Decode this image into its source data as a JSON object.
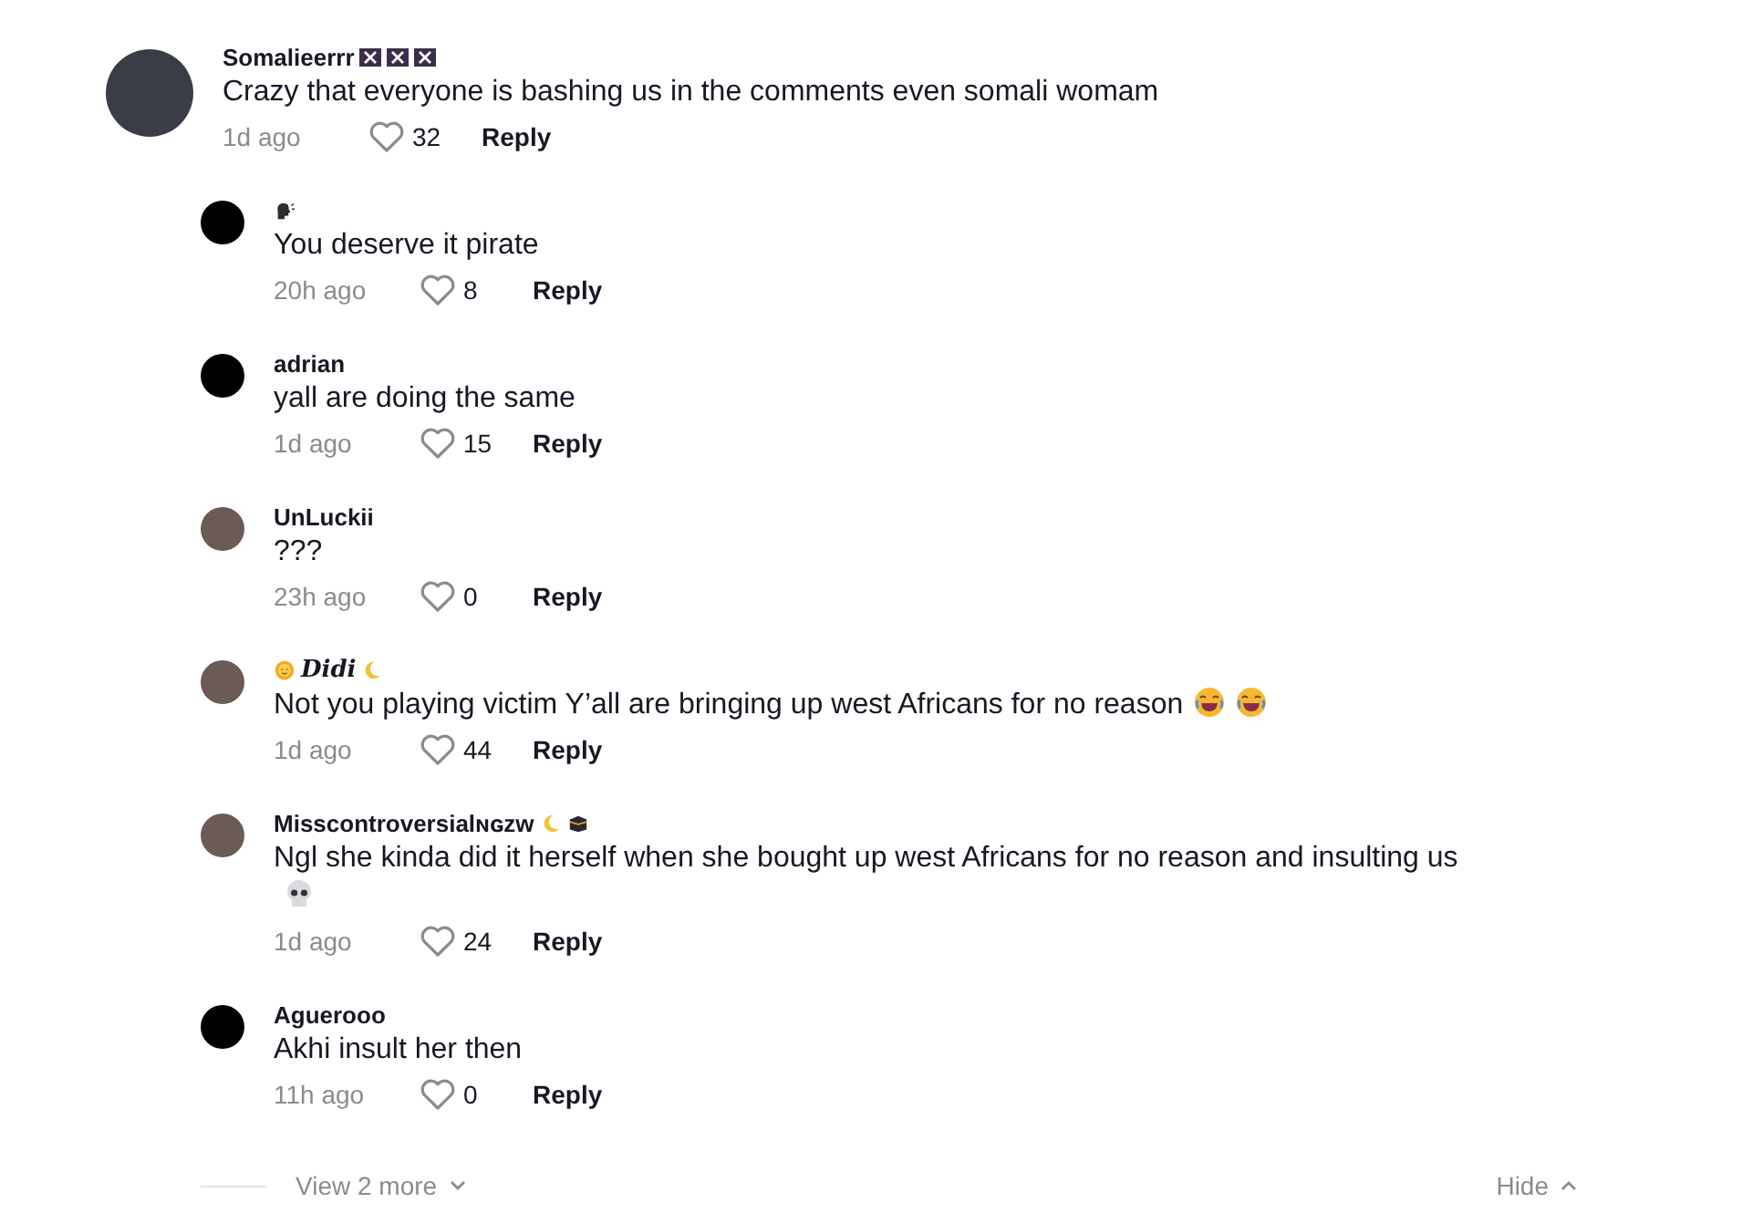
{
  "comment": {
    "author": {
      "text": "Somalieerrr",
      "kind": "plain"
    },
    "author_badges": [
      {
        "kind": "flag"
      },
      {
        "kind": "flag"
      },
      {
        "kind": "flag"
      }
    ],
    "avatar": {
      "kind": "photo"
    },
    "text": "Crazy that everyone is bashing us in the comments even somali womam",
    "time": "1d ago",
    "likes": "32",
    "reply": "Reply"
  },
  "replies": [
    {
      "author_badges_before": [
        {
          "kind": "speaking-head"
        }
      ],
      "avatar": {
        "kind": "blank"
      },
      "text": "You deserve it pirate",
      "time": "20h ago",
      "likes": "8",
      "reply": "Reply"
    },
    {
      "author": {
        "text": "adrian",
        "kind": "plain"
      },
      "avatar": {
        "kind": "blank"
      },
      "text": "yall are doing the same",
      "time": "1d ago",
      "likes": "15",
      "reply": "Reply"
    },
    {
      "author": {
        "text": "UnLuckii",
        "kind": "plain"
      },
      "avatar": {
        "kind": "photo"
      },
      "text": "???",
      "time": "23h ago",
      "likes": "0",
      "reply": "Reply"
    },
    {
      "author": {
        "text": "Didi",
        "kind": "script"
      },
      "author_badges_before": [
        {
          "kind": "sun"
        }
      ],
      "author_badges": [
        {
          "kind": "moon"
        }
      ],
      "avatar": {
        "kind": "photo"
      },
      "text": "Not you playing victim Y’all are bringing up west Africans for no reason",
      "emojis": [
        {
          "kind": "laughing"
        },
        {
          "kind": "laughing"
        }
      ],
      "time": "1d ago",
      "likes": "44",
      "reply": "Reply"
    },
    {
      "author": {
        "text": "Misscontroversialɴɢᴢᴡ",
        "kind": "plain"
      },
      "author_badges": [
        {
          "kind": "moon"
        },
        {
          "kind": "kaaba"
        }
      ],
      "avatar": {
        "kind": "photo"
      },
      "text": "Ngl she kinda did it herself when she bought up west Africans for no reason and insulting us",
      "emojis": [
        {
          "kind": "skull"
        }
      ],
      "time": "1d ago",
      "likes": "24",
      "reply": "Reply"
    },
    {
      "author": {
        "text": "Aguerooo",
        "kind": "plain"
      },
      "avatar": {
        "kind": "blank"
      },
      "text": "Akhi insult her then",
      "time": "11h ago",
      "likes": "0",
      "reply": "Reply"
    }
  ],
  "footer": {
    "view_more": "View 2 more",
    "hide": "Hide"
  }
}
